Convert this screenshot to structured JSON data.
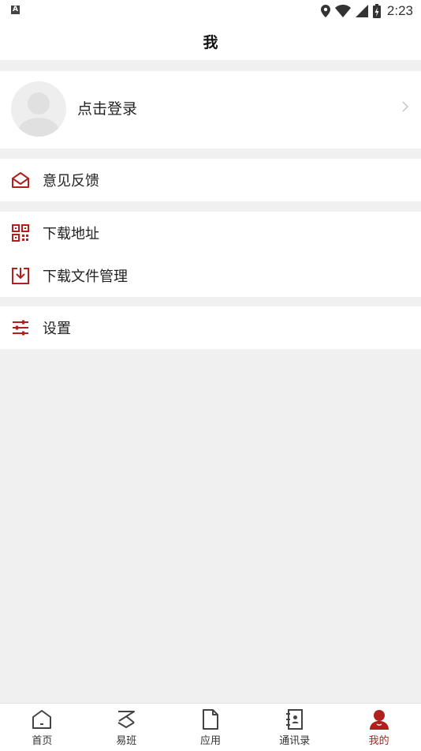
{
  "status_bar": {
    "time": "2:23",
    "indicator": "A"
  },
  "header": {
    "title": "我"
  },
  "profile": {
    "login_text": "点击登录"
  },
  "menu": {
    "feedback": "意见反馈",
    "download_address": "下载地址",
    "download_files": "下载文件管理",
    "settings": "设置"
  },
  "tabbar": {
    "items": [
      {
        "label": "首页",
        "icon": "home-icon"
      },
      {
        "label": "易班",
        "icon": "yiban-icon"
      },
      {
        "label": "应用",
        "icon": "document-icon"
      },
      {
        "label": "通讯录",
        "icon": "contacts-icon"
      },
      {
        "label": "我的",
        "icon": "person-icon"
      }
    ],
    "active_index": 4
  },
  "colors": {
    "accent": "#b0211e",
    "background": "#f0f0f0"
  }
}
